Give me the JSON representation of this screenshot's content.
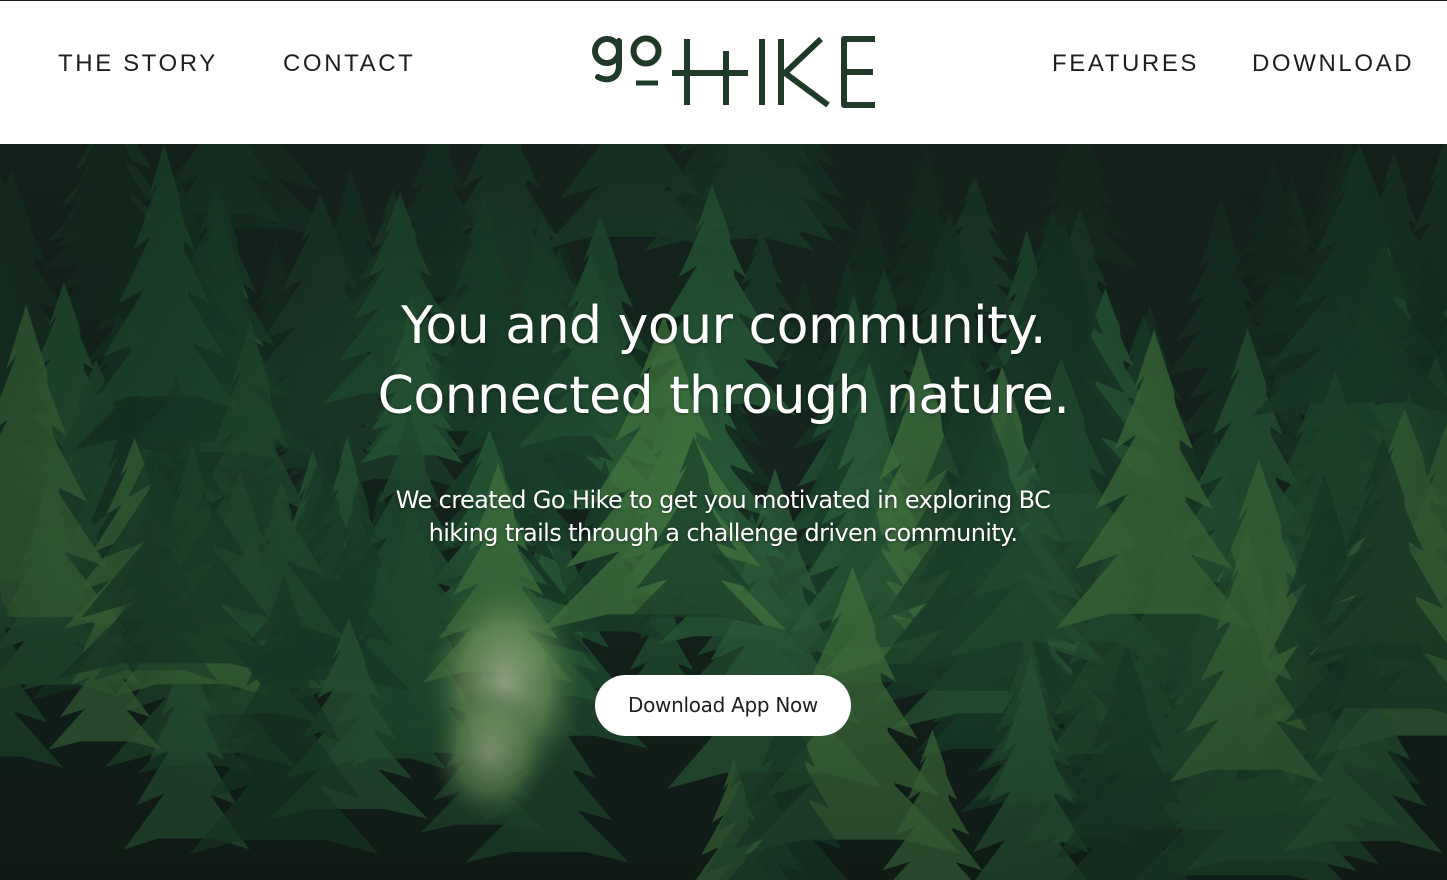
{
  "header": {
    "nav_left": [
      {
        "label": "THE STORY"
      },
      {
        "label": "CONTACT"
      }
    ],
    "logo": {
      "text_small": "go",
      "text_large": "HIKE",
      "color": "#1f3a28"
    },
    "nav_right": [
      {
        "label": "FEATURES"
      },
      {
        "label": "DOWNLOAD"
      }
    ]
  },
  "hero": {
    "headline_line1": "You and your community.",
    "headline_line2": "Connected through nature.",
    "subtext_line1": "We created Go Hike to get you motivated in exploring BC",
    "subtext_line2": "hiking trails through a challenge driven community.",
    "cta_label": "Download App Now",
    "background": "forest-photo",
    "colors": {
      "forest_dark": "#162620",
      "forest_mid": "#1f4a30",
      "forest_light": "#4f8a4a",
      "text": "#ffffff"
    }
  }
}
